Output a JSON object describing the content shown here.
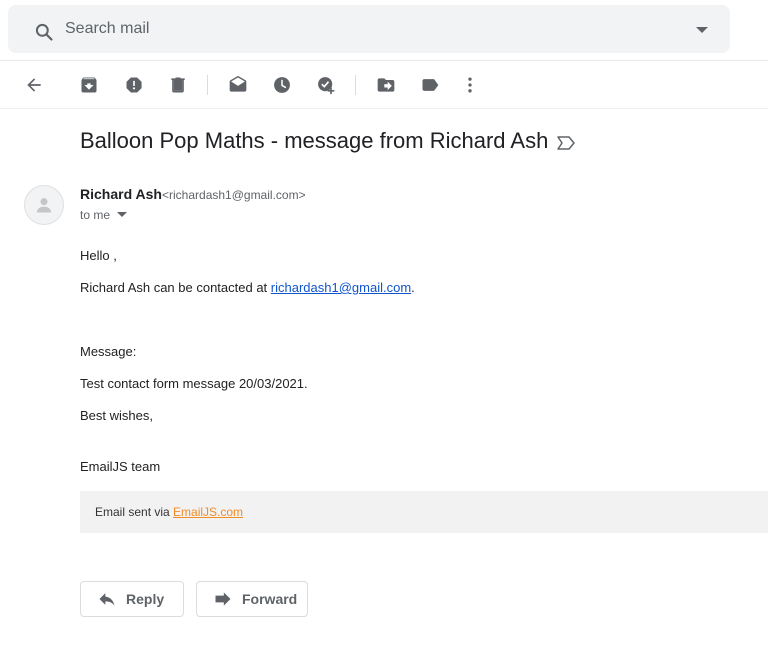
{
  "search": {
    "placeholder": "Search mail"
  },
  "toolbar": {
    "icons": [
      "back-arrow-icon",
      "archive-icon",
      "report-spam-icon",
      "delete-icon",
      "mark-unread-icon",
      "snooze-icon",
      "add-to-tasks-icon",
      "move-to-icon",
      "labels-icon",
      "more-vert-icon"
    ],
    "icon_color": "#5f6368"
  },
  "email": {
    "subject": "Balloon Pop Maths - message from Richard Ash",
    "sender_name": "Richard Ash",
    "sender_email": "<richardash1@gmail.com>",
    "recipient": "to me",
    "greeting": "Hello ,",
    "contact_prefix": "Richard Ash can be contacted at ",
    "contact_link": "richardash1@gmail.com",
    "contact_suffix": ".",
    "message_label": "Message:",
    "message_text": "Test contact form message 20/03/2021.",
    "sign_off": "Best wishes,",
    "team": "EmailJS team",
    "footer_prefix": "Email sent via ",
    "footer_link": "EmailJS.com"
  },
  "actions": {
    "reply_label": "Reply",
    "forward_label": "Forward"
  },
  "colors": {
    "link": "#1155cc",
    "footer_link": "#f28c28",
    "search_bg": "#f1f3f4",
    "footer_bg": "#f2f2f2"
  }
}
